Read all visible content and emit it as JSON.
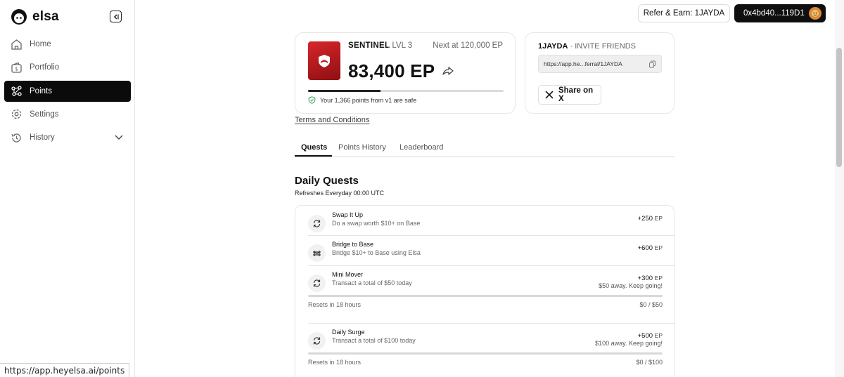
{
  "brand": {
    "name": "elsa"
  },
  "sidebar": {
    "items": [
      {
        "label": "Home",
        "icon": "home-icon"
      },
      {
        "label": "Portfolio",
        "icon": "wallet-icon"
      },
      {
        "label": "Points",
        "icon": "points-icon",
        "active": true
      },
      {
        "label": "Settings",
        "icon": "gear-icon"
      },
      {
        "label": "History",
        "icon": "history-icon"
      }
    ]
  },
  "header": {
    "refer_label": "Refer & Earn: 1JAYDA",
    "wallet_label": "0x4bd40...119D1"
  },
  "points_card": {
    "tier": "SENTINEL",
    "level": ". LVL 3",
    "next": "Next at 120,000 EP",
    "points": "83,400 EP",
    "progress_fraction": 0.37,
    "safe_text": "Your 1,366 points from v1 are safe"
  },
  "invite_card": {
    "code": "1JAYDA",
    "title_suffix": "· INVITE FRIENDS",
    "link": "https://app.he...ferral/1JAYDA",
    "share_label": "Share on X"
  },
  "terms_label": "Terms and Conditions",
  "tabs": [
    "Quests",
    "Points History",
    "Leaderboard"
  ],
  "daily": {
    "title": "Daily Quests",
    "subtitle": "Refreshes Everyday 00:00 UTC",
    "quests": [
      {
        "name": "Swap It Up",
        "desc": "Do a swap worth $10+ on Base",
        "ep": "+250",
        "unit": "EP"
      },
      {
        "name": "Bridge to Base",
        "desc": "Bridge $10+ to Base using Elsa",
        "ep": "+600",
        "unit": "EP"
      },
      {
        "name": "Mini Mover",
        "desc": "Transact a total of $50 today",
        "ep": "+300",
        "unit": "EP",
        "msg": "$50 away. Keep going!",
        "resets": "Resets in 18 hours",
        "count": "$0 / $50",
        "progress_fraction": 0
      },
      {
        "name": "Daily Surge",
        "desc": "Transact a total of $100 today",
        "ep": "+500",
        "unit": "EP",
        "msg": "$100 away. Keep going!",
        "resets": "Resets in 18 hours",
        "count": "$0 / $100",
        "progress_fraction": 0
      }
    ]
  },
  "status_bar": {
    "url": "https://app.heyelsa.ai/points"
  },
  "colors": {
    "accent": "#0b0b0b",
    "badge_red": "#c4181d",
    "safe_green": "#2f9e55"
  }
}
